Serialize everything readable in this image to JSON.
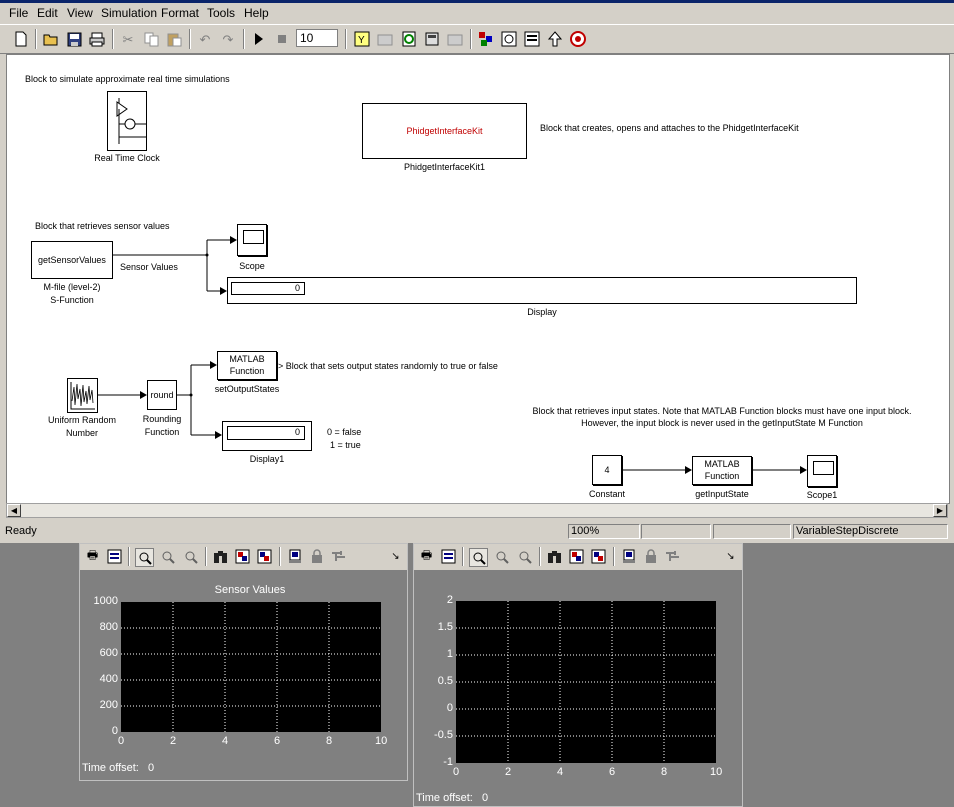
{
  "menu": [
    "File",
    "Edit",
    "View",
    "Simulation",
    "Format",
    "Tools",
    "Help"
  ],
  "toolbar": {
    "stop_time": "10",
    "icons": [
      "new-icon",
      "open-icon",
      "save-icon",
      "print-icon",
      "cut-icon",
      "copy-icon",
      "paste-icon",
      "undo-icon",
      "redo-icon",
      "play-icon",
      "stop-icon",
      "build-icon",
      "library-icon",
      "refresh-icon",
      "model-icon",
      "debug-icon",
      "browser-icon",
      "explorer-icon",
      "properties-icon",
      "up-icon",
      "help-icon"
    ]
  },
  "diagram": {
    "note_rtc": "Block to simulate approximate real time simulations",
    "rtc_label": "Real Time Clock",
    "phidget_block_text": "PhidgetInterfaceKit",
    "phidget_label": "PhidgetInterfaceKit1",
    "note_phidget": "Block that creates, opens and attaches to the PhidgetInterfaceKit",
    "note_sensor": "Block that retrieves sensor values",
    "getsensor_text": "getSensorValues",
    "getsensor_label1": "M-file (level-2)",
    "getsensor_label2": "S-Function",
    "signal_label": "Sensor Values",
    "scope_label": "Scope",
    "display_value": "0",
    "display_label": "Display",
    "urn_label1": "Uniform Random",
    "urn_label2": "Number",
    "round_text": "round",
    "round_label1": "Rounding",
    "round_label2": "Function",
    "matlab_fn_line1": "MATLAB",
    "matlab_fn_line2": "Function",
    "setoutput_label": "setOutputStates",
    "note_setoutput": "Block that sets output states randomly to true or false",
    "display1_value": "0",
    "display1_label": "Display1",
    "legend_false": "0 = false",
    "legend_true": "1 = true",
    "note_input1": "Block that retrieves input states. Note that MATLAB Function blocks must have one input block.",
    "note_input2": "However, the input block is never used in the getInputState M Function",
    "constant_value": "4",
    "constant_label": "Constant",
    "getinput_line1": "MATLAB",
    "getinput_line2": "Function",
    "getinput_label": "getInputState",
    "scope1_label": "Scope1"
  },
  "status": {
    "ready": "Ready",
    "zoom": "100%",
    "solver": "VariableStepDiscrete"
  },
  "scope1": {
    "title": "Sensor Values",
    "x_ticks": [
      "0",
      "2",
      "4",
      "6",
      "8",
      "10"
    ],
    "y_ticks": [
      "1000",
      "800",
      "600",
      "400",
      "200",
      "0"
    ],
    "time_offset_label": "Time offset:",
    "time_offset_value": "0"
  },
  "scope2": {
    "title": "",
    "x_ticks": [
      "0",
      "2",
      "4",
      "6",
      "8",
      "10"
    ],
    "y_ticks": [
      "2",
      "1.5",
      "1",
      "0.5",
      "0",
      "-0.5",
      "-1"
    ],
    "time_offset_label": "Time offset:",
    "time_offset_value": "0"
  },
  "colors": {
    "window": "#d4d0c8",
    "phidget_text": "#c00000",
    "plot_bg": "#000000",
    "grid": "#ffffff"
  }
}
